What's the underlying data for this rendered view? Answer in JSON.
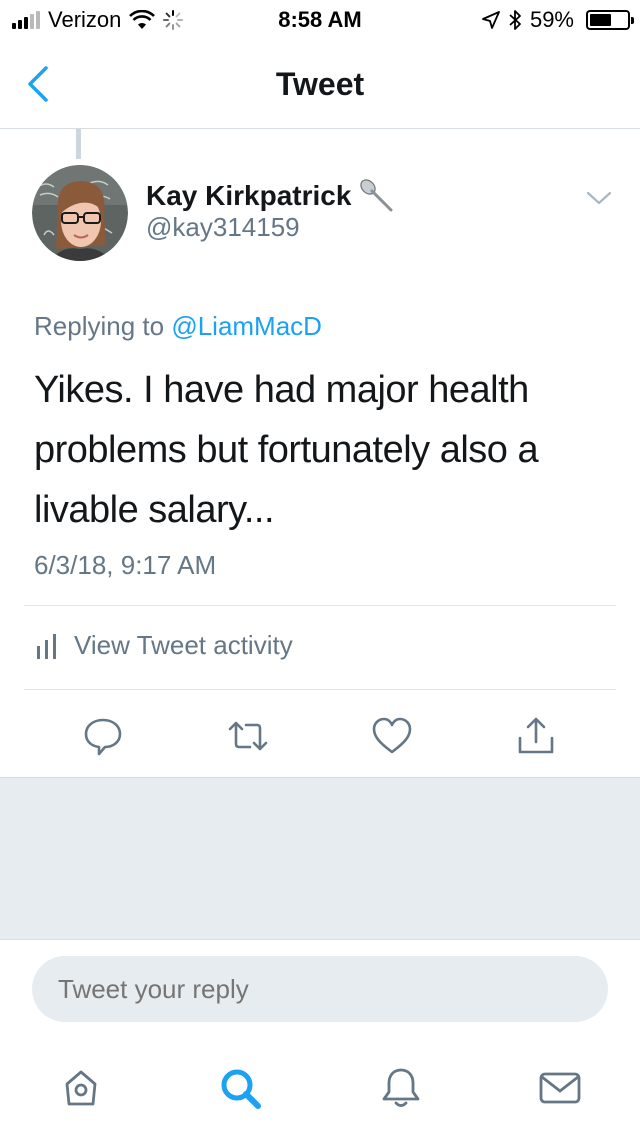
{
  "status_bar": {
    "carrier": "Verizon",
    "time": "8:58 AM",
    "battery_percent_label": "59%",
    "battery_level": 0.59
  },
  "nav": {
    "title": "Tweet",
    "back_icon": "chevron-left-icon"
  },
  "tweet": {
    "author_name": "Kay Kirkpatrick",
    "author_handle": "@kay314159",
    "replying_prefix": "Replying to",
    "replying_to": "@LiamMacD",
    "text": "Yikes. I have had major health problems but fortunately also a livable salary...",
    "timestamp": "6/3/18, 9:17 AM",
    "activity_label": "View Tweet activity"
  },
  "reply": {
    "placeholder": "Tweet your reply"
  },
  "actions": [
    "reply-icon",
    "retweet-icon",
    "like-icon",
    "share-icon"
  ],
  "tabs": [
    "home-icon",
    "search-icon",
    "notifications-icon",
    "messages-icon"
  ],
  "colors": {
    "accent": "#1da1f2",
    "secondary_text": "#657786",
    "divider": "#e1e8ed",
    "grey_background": "#e6ecf0"
  }
}
